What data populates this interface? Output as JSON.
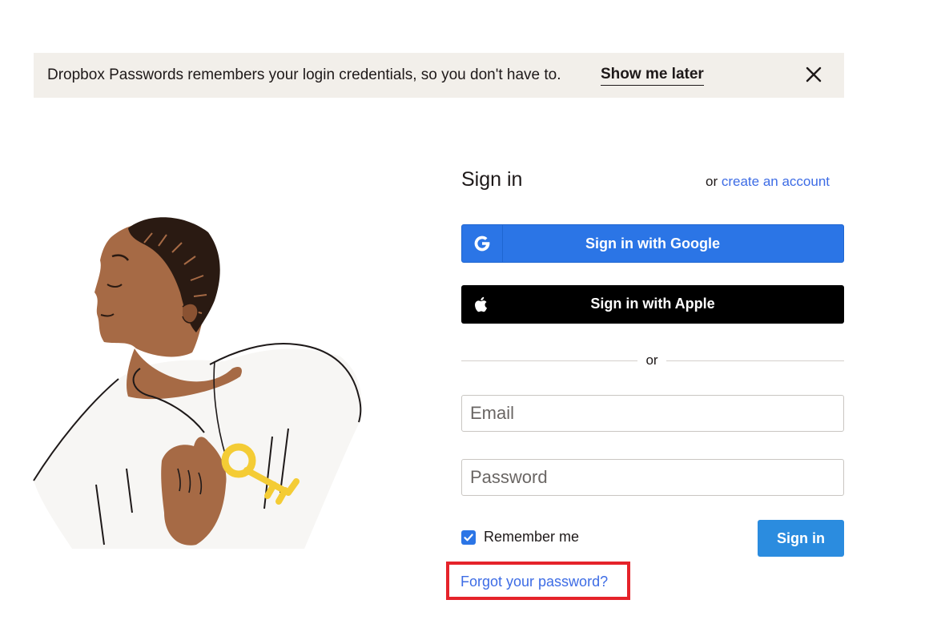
{
  "banner": {
    "message": "Dropbox Passwords remembers your login credentials, so you don't have to.",
    "action_label": "Show me later",
    "close_icon": "close-icon"
  },
  "signin": {
    "title": "Sign in",
    "or_prefix": "or",
    "create_account_label": "create an account",
    "google_label": "Sign in with Google",
    "google_icon": "google-icon",
    "apple_label": "Sign in with Apple",
    "apple_icon": "apple-icon",
    "divider_label": "or",
    "email_placeholder": "Email",
    "email_value": "",
    "password_placeholder": "Password",
    "password_value": "",
    "remember_label": "Remember me",
    "remember_checked": true,
    "submit_label": "Sign in",
    "forgot_label": "Forgot your password?"
  },
  "colors": {
    "banner_bg": "#f2efea",
    "google_blue": "#2b75e6",
    "link_blue": "#3d6ce5",
    "highlight_red": "#e5232a"
  }
}
